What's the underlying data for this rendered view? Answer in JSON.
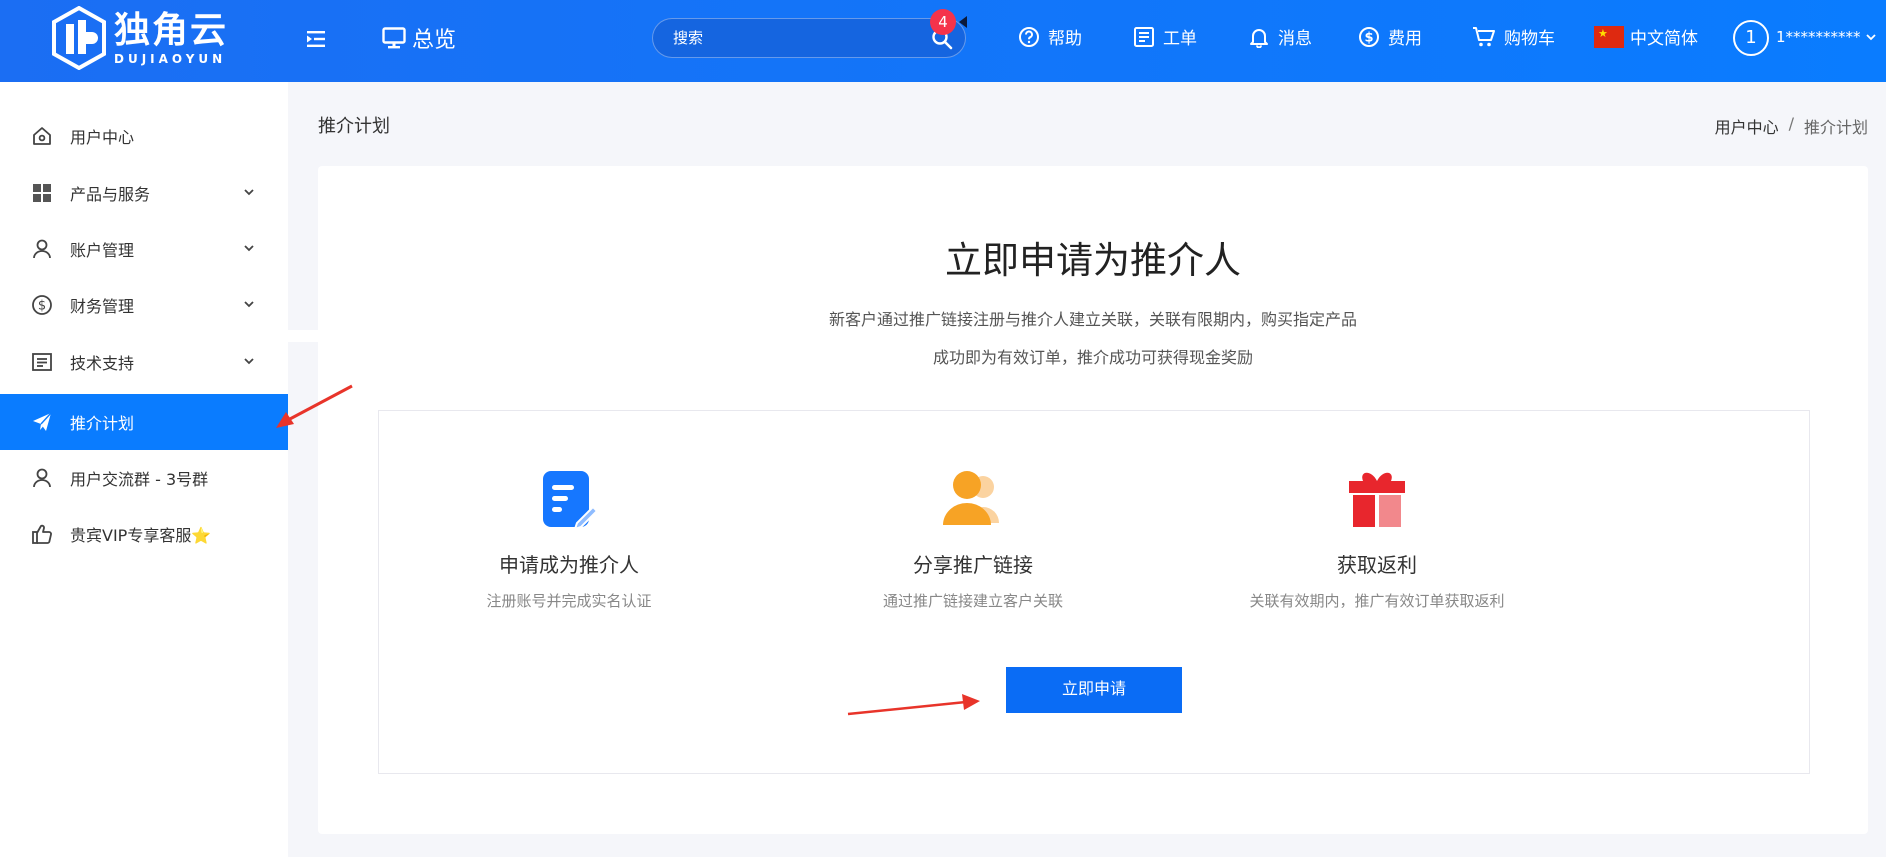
{
  "header": {
    "logo_title": "独角云",
    "logo_sub": "DUJIAOYUN",
    "overview": "总览",
    "search_placeholder": "搜索",
    "notification_count": "4",
    "nav": [
      {
        "label": "帮助",
        "icon": "help-circle-icon"
      },
      {
        "label": "工单",
        "icon": "ticket-icon"
      },
      {
        "label": "消息",
        "icon": "bell-icon"
      },
      {
        "label": "费用",
        "icon": "dollar-icon"
      },
      {
        "label": "购物车",
        "icon": "cart-icon"
      },
      {
        "label": "中文简体",
        "icon": "china-flag-icon"
      }
    ],
    "avatar_text": "1",
    "username": "1**********"
  },
  "sidebar": {
    "items": [
      {
        "label": "用户中心",
        "icon": "home-icon"
      },
      {
        "label": "产品与服务",
        "icon": "grid-icon"
      },
      {
        "label": "账户管理",
        "icon": "user-icon"
      },
      {
        "label": "财务管理",
        "icon": "dollar-icon"
      },
      {
        "label": "技术支持",
        "icon": "document-icon"
      },
      {
        "label": "推介计划",
        "icon": "paper-plane-icon"
      },
      {
        "label": "用户交流群 - 3号群",
        "icon": "user-icon"
      },
      {
        "label": "贵宾VIP专享客服⭐",
        "icon": "thumbs-up-icon"
      }
    ],
    "active_index": 5
  },
  "main": {
    "page_title": "推介计划",
    "breadcrumb": [
      "用户中心",
      "/",
      "推介计划"
    ],
    "hero_title": "立即申请为推介人",
    "hero_desc_line1": "新客户通过推广链接注册与推介人建立关联，关联有限期内，购买指定产品",
    "hero_desc_line2": "成功即为有效订单，推介成功可获得现金奖励",
    "steps": [
      {
        "title": "申请成为推介人",
        "desc": "注册账号并完成实名认证",
        "icon": "edit-document-icon"
      },
      {
        "title": "分享推广链接",
        "desc": "通过推广链接建立客户关联",
        "icon": "users-icon"
      },
      {
        "title": "获取返利",
        "desc": "关联有效期内，推广有效订单获取返利",
        "icon": "gift-icon"
      }
    ],
    "apply_button": "立即申请"
  },
  "colors": {
    "primary": "#0a7cff",
    "badge": "#f5334b",
    "annotation_arrow": "#e8342a",
    "step_icon_blue": "#1677ff",
    "step_icon_orange": "#f7a325",
    "step_icon_red": "#e8262d"
  }
}
